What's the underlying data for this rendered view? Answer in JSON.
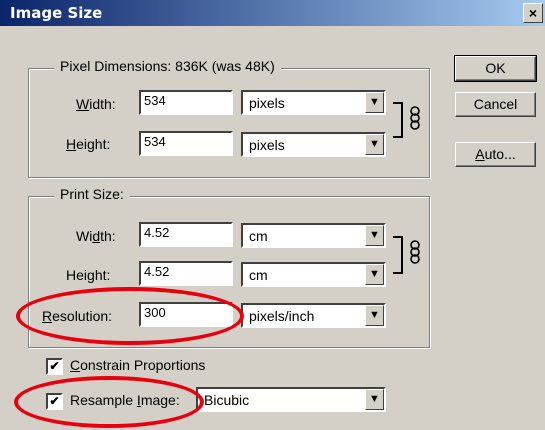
{
  "window": {
    "title": "Image Size",
    "close_label": "×"
  },
  "pixel_dimensions": {
    "legend": "Pixel Dimensions:  836K (was 48K)",
    "width_label_u": "W",
    "width_label_rest": "idth:",
    "width_value": "534",
    "width_unit": "pixels",
    "height_label_u": "H",
    "height_label_rest": "eight:",
    "height_value": "534",
    "height_unit": "pixels"
  },
  "print_size": {
    "legend": "Print Size:",
    "width_label_pre": "Wi",
    "width_label_u": "d",
    "width_label_rest": "th:",
    "width_value": "4.52",
    "width_unit": "cm",
    "height_label_pre": "Hei",
    "height_label_u": "g",
    "height_label_rest": "ht:",
    "height_value": "4.52",
    "height_unit": "cm",
    "resolution_label_u": "R",
    "resolution_label_rest": "esolution:",
    "resolution_value": "300",
    "resolution_unit": "pixels/inch"
  },
  "options": {
    "constrain_u": "C",
    "constrain_rest": "onstrain Proportions",
    "constrain_checked": "✔",
    "resample_pre": "Resample ",
    "resample_u": "I",
    "resample_rest": "mage:",
    "resample_checked": "✔",
    "resample_method": "Bicubic"
  },
  "buttons": {
    "ok": "OK",
    "cancel": "Cancel",
    "auto_u": "A",
    "auto_rest": "uto..."
  },
  "arrow_glyph": "▼",
  "annotation_color": "#e8000d"
}
